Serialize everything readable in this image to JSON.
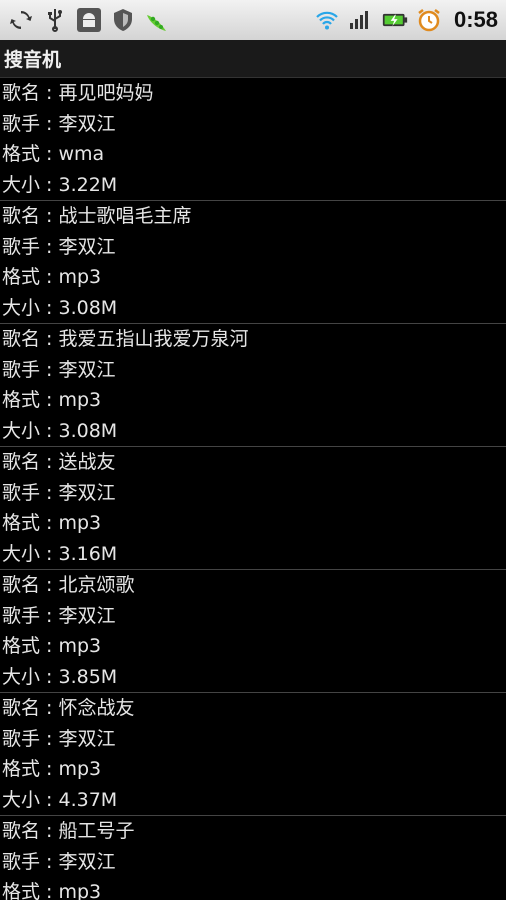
{
  "statusbar": {
    "left_icons": [
      "sync-icon",
      "usb-icon",
      "android-debug-icon",
      "shield-icon",
      "peapod-app-icon"
    ],
    "right_icons": [
      "wifi-icon",
      "signal-icon",
      "battery-charging-icon",
      "alarm-clock-icon"
    ],
    "time": "0:58"
  },
  "app": {
    "title": "搜音机"
  },
  "labels": {
    "name": "歌名 : ",
    "singer": "歌手 : ",
    "format": "格式 : ",
    "size": "大小 : "
  },
  "songs": [
    {
      "name": "再见吧妈妈",
      "singer": "李双江",
      "format": "wma",
      "size": "3.22M"
    },
    {
      "name": "战士歌唱毛主席",
      "singer": "李双江",
      "format": "mp3",
      "size": "3.08M"
    },
    {
      "name": "我爱五指山我爱万泉河",
      "singer": "李双江",
      "format": "mp3",
      "size": "3.08M"
    },
    {
      "name": "送战友",
      "singer": "李双江",
      "format": "mp3",
      "size": "3.16M"
    },
    {
      "name": "北京颂歌",
      "singer": "李双江",
      "format": "mp3",
      "size": "3.85M"
    },
    {
      "name": "怀念战友",
      "singer": "李双江",
      "format": "mp3",
      "size": "4.37M"
    },
    {
      "name": "船工号子",
      "singer": "李双江",
      "format": "mp3",
      "size": ""
    }
  ]
}
